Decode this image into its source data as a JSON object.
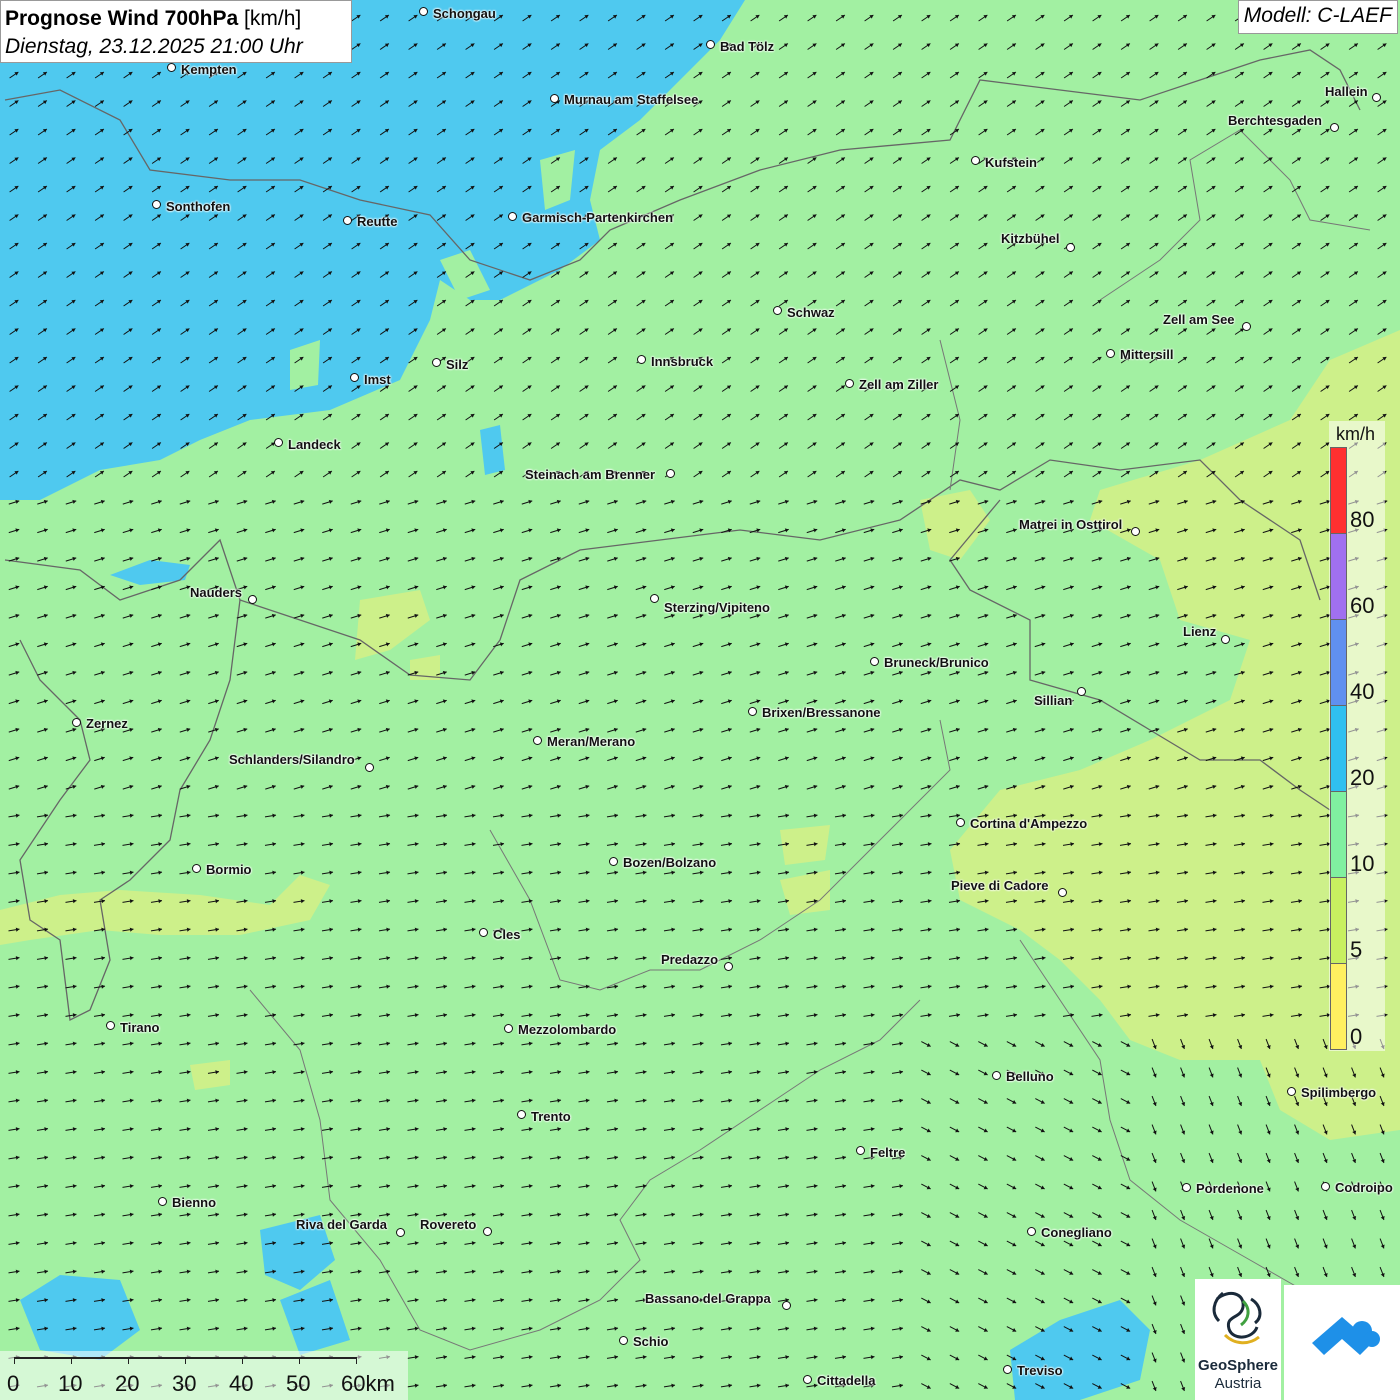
{
  "header": {
    "title_bold": "Prognose Wind 700hPa",
    "title_unit": " [km/h]",
    "datetime": "Dienstag, 23.12.2025 21:00 Uhr",
    "model": "Modell: C-LAEF"
  },
  "legend": {
    "unit": "km/h",
    "labels": [
      "80",
      "60",
      "40",
      "20",
      "10",
      "5",
      "0"
    ],
    "colors": [
      "#ff3030",
      "#a070f0",
      "#6090f0",
      "#30c0f0",
      "#80f0a0",
      "#c8f060",
      "#fff060"
    ]
  },
  "scale": {
    "labels": [
      "0",
      "10",
      "20",
      "30",
      "40",
      "50",
      "60km"
    ]
  },
  "logos": {
    "geosphere_name": "GeoSphere",
    "geosphere_sub": "Austria"
  },
  "cities": [
    {
      "name": "Schongau"
    },
    {
      "name": "Bad Tölz"
    },
    {
      "name": "Kempten"
    },
    {
      "name": "Murnau am Staffelsee"
    },
    {
      "name": "Hallein"
    },
    {
      "name": "Berchtesgaden"
    },
    {
      "name": "Kufstein"
    },
    {
      "name": "Sonthofen"
    },
    {
      "name": "Reutte"
    },
    {
      "name": "Garmisch-Partenkirchen"
    },
    {
      "name": "Kitzbühel"
    },
    {
      "name": "Schwaz"
    },
    {
      "name": "Zell am See"
    },
    {
      "name": "Mittersill"
    },
    {
      "name": "Innsbruck"
    },
    {
      "name": "Silz"
    },
    {
      "name": "Imst"
    },
    {
      "name": "Zell am Ziller"
    },
    {
      "name": "Landeck"
    },
    {
      "name": "Steinach am Brenner"
    },
    {
      "name": "Matrei in Osttirol"
    },
    {
      "name": "Nauders"
    },
    {
      "name": "Sterzing/Vipiteno"
    },
    {
      "name": "Lienz"
    },
    {
      "name": "Bruneck/Brunico"
    },
    {
      "name": "Sillian"
    },
    {
      "name": "Brixen/Bressanone"
    },
    {
      "name": "Zernez"
    },
    {
      "name": "Meran/Merano"
    },
    {
      "name": "Schlanders/Silandro"
    },
    {
      "name": "Cortina d'Ampezzo"
    },
    {
      "name": "Bozen/Bolzano"
    },
    {
      "name": "Bormio"
    },
    {
      "name": "Pieve di Cadore"
    },
    {
      "name": "Cles"
    },
    {
      "name": "Predazzo"
    },
    {
      "name": "Tirano"
    },
    {
      "name": "Mezzolombardo"
    },
    {
      "name": "Belluno"
    },
    {
      "name": "Spilimbergo"
    },
    {
      "name": "Trento"
    },
    {
      "name": "Feltre"
    },
    {
      "name": "Pordenone"
    },
    {
      "name": "Codroipo"
    },
    {
      "name": "Bienno"
    },
    {
      "name": "Riva del Garda"
    },
    {
      "name": "Rovereto"
    },
    {
      "name": "Conegliano"
    },
    {
      "name": "Bassano del Grappa"
    },
    {
      "name": "Schio"
    },
    {
      "name": "Treviso"
    },
    {
      "name": "Cittadella"
    }
  ]
}
